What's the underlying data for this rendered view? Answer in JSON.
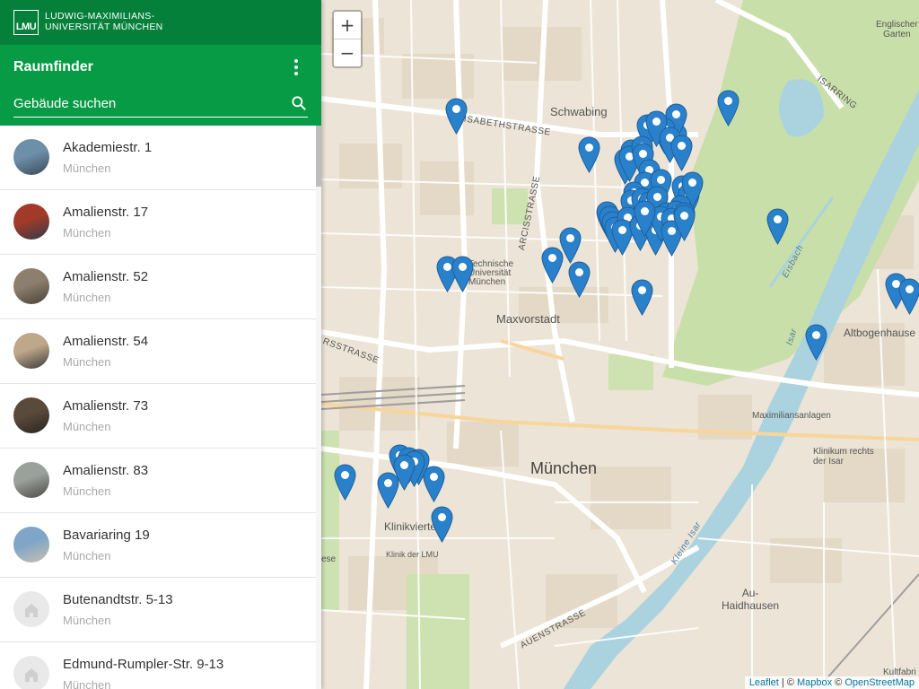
{
  "header": {
    "logo_text": "LMU",
    "university_line1": "LUDWIG-MAXIMILIANS-",
    "university_line2": "UNIVERSITÄT MÜNCHEN",
    "app_title": "Raumfinder",
    "search_placeholder": "Gebäude suchen"
  },
  "colors": {
    "brand_dark": "#04803a",
    "brand": "#089b46",
    "marker": "#2a81cb"
  },
  "buildings": [
    {
      "name": "Akademiestr. 1",
      "city": "München",
      "photo": true
    },
    {
      "name": "Amalienstr. 17",
      "city": "München",
      "photo": true
    },
    {
      "name": "Amalienstr. 52",
      "city": "München",
      "photo": true
    },
    {
      "name": "Amalienstr. 54",
      "city": "München",
      "photo": true
    },
    {
      "name": "Amalienstr. 73",
      "city": "München",
      "photo": true
    },
    {
      "name": "Amalienstr. 83",
      "city": "München",
      "photo": true
    },
    {
      "name": "Bavariaring 19",
      "city": "München",
      "photo": true
    },
    {
      "name": "Butenandtstr. 5-13",
      "city": "München",
      "photo": false
    },
    {
      "name": "Edmund-Rumpler-Str. 9-13",
      "city": "München",
      "photo": false
    }
  ],
  "map": {
    "zoom_in": "+",
    "zoom_out": "−",
    "labels": {
      "schwabing": "Schwabing",
      "maxvorstadt": "Maxvorstadt",
      "muenchen": "München",
      "tu_line1": "Technische",
      "tu_line2": "Universität",
      "tu_line3": "München",
      "englischer_line1": "Englischer",
      "englischer_line2": "Garten",
      "altbogenhausen": "Altbogenhause",
      "maximiliansanlagen": "Maximiliansanlagen",
      "klinikum_line1": "Klinikum rechts",
      "klinikum_line2": "der Isar",
      "klinikviertel": "Klinikviertel",
      "klinik_lmu": "Klinik der LMU",
      "au_line1": "Au-",
      "au_line2": "Haidhausen",
      "kultfabrik": "Kultfabri",
      "ese": "ese",
      "elisabethstrasse": "ELISABETHSTRASSE",
      "arcisstrasse": "ARCISSTRASSE",
      "isarring": "ISARRING",
      "auenstrasse": "AUENSTRASSE",
      "rsstrasse": "RSSTRASSE",
      "eisbach": "Eisbach",
      "isar": "Isar",
      "kleine_isar": "Kleine Isar"
    },
    "marker_count": 62,
    "attribution": {
      "leaflet": "Leaflet",
      "sep1": " | © ",
      "mapbox": "Mapbox",
      "sep2": " © ",
      "osm": "OpenStreetMap"
    }
  }
}
